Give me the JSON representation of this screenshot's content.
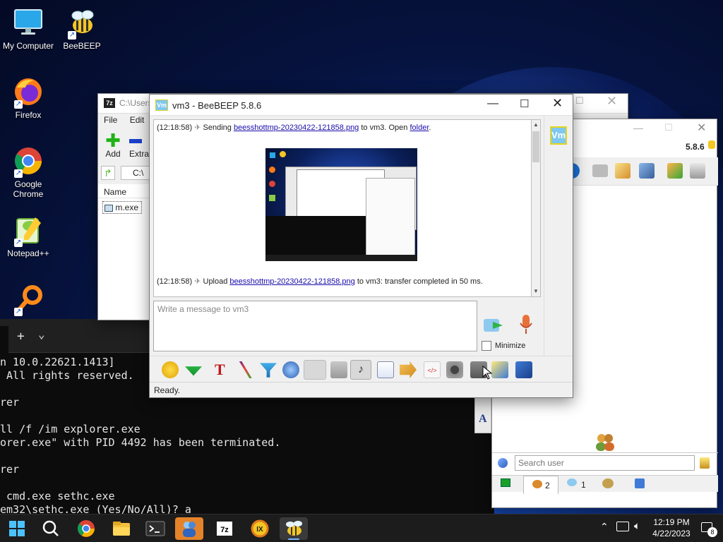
{
  "desktop": {
    "icons": [
      {
        "label": "My Computer"
      },
      {
        "label": "BeeBEEP"
      },
      {
        "label": "Firefox"
      },
      {
        "label": "Google Chrome"
      },
      {
        "label": "Notepad++"
      }
    ]
  },
  "terminal": {
    "tab_add": "+",
    "tab_dropdown": "⌄",
    "lines": [
      "n 10.0.22621.1413]",
      " All rights reserved.",
      "rer",
      "ll /f /im explorer.exe",
      "orer.exe\" with PID 4492 has been terminated.",
      "rer",
      " cmd.exe sethc.exe",
      "em32\\sethc.exe (Yes/No/All)? a"
    ]
  },
  "zip": {
    "title": "C:\\Users",
    "menu": [
      "File",
      "Edit"
    ],
    "toolbar": {
      "add": "Add",
      "extract": "Extra"
    },
    "path": "C:\\",
    "column_name": "Name",
    "file": "m.exe"
  },
  "contacts": {
    "version": "5.8.6",
    "search_placeholder": "Search user",
    "tabs": [
      {
        "count": "2"
      },
      {
        "count": "1"
      },
      {
        "count": ""
      },
      {
        "count": ""
      }
    ]
  },
  "chat": {
    "title": "vm3 - BeeBEEP 5.8.6",
    "badge": "Vm",
    "msg1": {
      "time": "(12:18:58)",
      "pre": "Sending",
      "file": "beesshottmp-20230422-121858.png",
      "mid": "to vm3. Open",
      "folder": "folder",
      "post": "."
    },
    "msg2": {
      "time": "(12:18:58)",
      "pre": "Upload",
      "file": "beesshottmp-20230422-121858.png",
      "post": "to vm3: transfer completed in 50 ms."
    },
    "input_placeholder": "Write a message to vm3",
    "minimize_label": "Minimize",
    "status": "Ready."
  },
  "taskbar": {
    "time": "12:19 PM",
    "date": "4/22/2023",
    "notification_count": "8"
  },
  "colors": {
    "accent": "#0b5ed7",
    "link": "#1a0dab",
    "badge_bg": "#7ec8f0",
    "badge_border": "#e2d41f"
  }
}
